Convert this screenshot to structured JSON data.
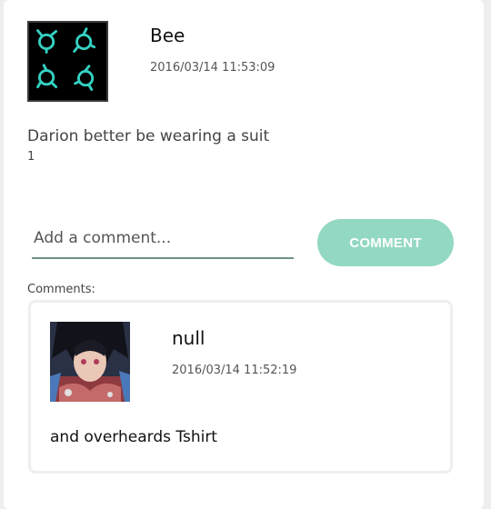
{
  "post": {
    "author": "Bee",
    "timestamp": "2016/03/14 11:53:09",
    "text": "Darion better be wearing a suit",
    "count": "1",
    "avatar_icon": "teal-symbols-avatar-icon"
  },
  "composer": {
    "placeholder": "Add a comment...",
    "button_label": "COMMENT",
    "accent_color": "#93d8c3"
  },
  "comments_label": "Comments:",
  "comments": [
    {
      "author": "null",
      "timestamp": "2016/03/14 11:52:19",
      "text": "and overheards Tshirt",
      "avatar_icon": "anime-character-avatar-icon"
    }
  ]
}
